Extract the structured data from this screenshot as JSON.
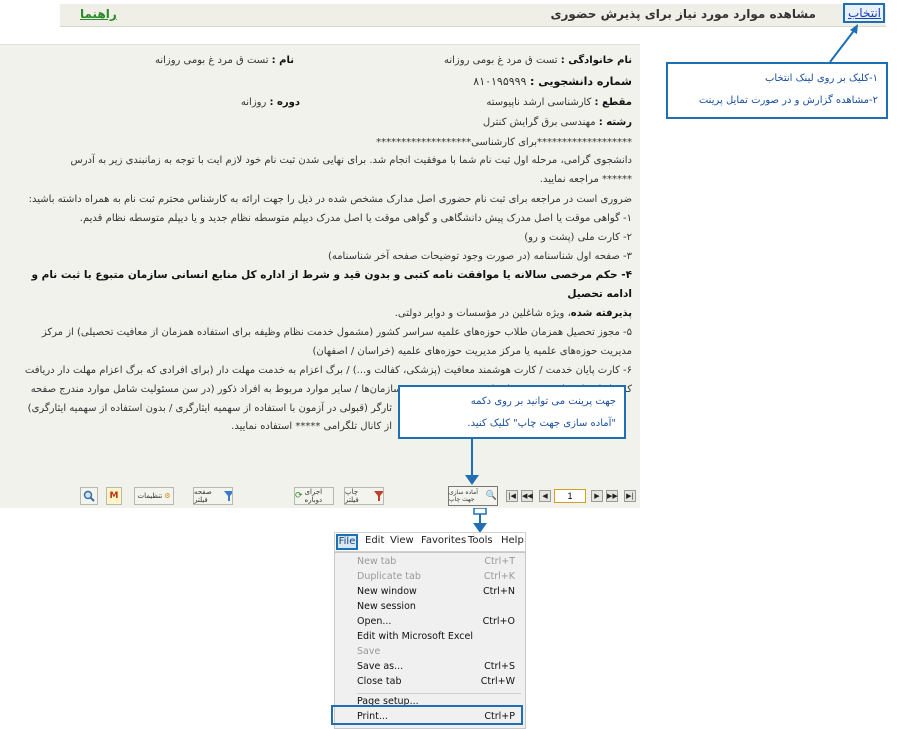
{
  "header": {
    "help_link": "راهنما",
    "title": "مشاهده موارد مورد نیاز برای پذیرش حضوری",
    "select_link": "انتخاب"
  },
  "student": {
    "last_name_label": "نام خانوادگی :",
    "last_name_value": "تست ق مرد غ بومی روزانه",
    "first_name_label": "نام :",
    "first_name_value": "تست ق مرد غ بومی روزانه",
    "student_id_label": "شماره دانشجویی :",
    "student_id_value": "۸۱۰۱۹۵۹۹۹",
    "level_label": "مقطع :",
    "level_value": "کارشناسی ارشد ناپیوسته",
    "period_label": "دوره :",
    "period_value": "روزانه",
    "major_label": "رشته :",
    "major_value": "مهندسی برق گرایش کنترل"
  },
  "body": {
    "stars_line": "*******************برای کارشناسی*******************",
    "para1": "دانشجوی گرامی، مرحله اول ثبت نام شما با موفقیت انجام شد. برای نهایی شدن ثبت نام خود لازم ایت با توجه به زمانبندی زیر به آدرس",
    "para1_cont": "****** مراجعه نمایید.",
    "para2": "ضروری است در مراجعه برای ثبت نام حضوری اصل مدارک مشخص شده در ذیل را جهت ارائه به کارشناس محترم ثبت نام به همراه داشته باشید:",
    "item1": "۱- گواهی موقت یا اصل مدرک پیش دانشگاهی و گواهی موقت یا اصل مدرک دیپلم متوسطه نظام جدید و یا دیپلم متوسطه نظام قدیم.",
    "item2": "۲- کارت ملی (پشت و رو)",
    "item3": "۳- صفحه اول شناسنامه (در صورت وجود توضیحات صفحه آخر شناسنامه)",
    "item4a": "۴- حکم مرخصی سالانه یا موافقت نامه",
    "item4b": "کتبی و بدون قید و شرط از اداره کل منابع انسانی سازمان متبوع با ثبت نام و ادامه تحصیل",
    "item4c": "پذیرفته شده",
    "item4d": "، ویژه شاغلین در مؤسسات و دوایر دولتی.",
    "item5": "۵- مجوز تحصیل همزمان طلاب حوزه‌های علمیه سراسر کشور (مشمول خدمت نظام وظیفه برای استفاده همزمان از معافیت تحصیلی) از مرکز",
    "item5_cont": "مدیریت حوزه‌های علمیه یا مرکز مدیریت حوزه‌های علمیه (خراسان / اصفهان)",
    "item6": "۶- کارت پایان خدمت / کارت هوشمند معافیت (پزشکی، کفالت و...) / برگ اعزام به خدمت مهلت دار (برای افرادی که برگ اعزام مهلت دار دریافت",
    "item6_cont": "کرده‌اند) / نامه یا مجوز مربوط برای متعهدین خدمت در سازمان‌ها / سایر موارد مربوط به افراد ذکور (در سن مسئولیت شامل موارد مندرج صفحه",
    "line_a": "ثارگر (قبولی در آزمون با استفاده از سهمیه ایثارگری / بدون استفاده از سهمیه ایثارگری)",
    "line_b": "از کانال تلگرامی ***** استفاده نمایید."
  },
  "callout1": {
    "line1": "۱-کلیک بر روی لینک انتخاب",
    "line2": "۲-مشاهده گزارش و در صورت تمایل پرینت"
  },
  "callout2": {
    "line1": "جهت پرینت می توانید بر روی دکمه",
    "line2": "\"آماده سازی جهت چاپ\" کلیک کنید."
  },
  "toolbar": {
    "search_icon": "search-icon",
    "settings_label": "تنظیمات",
    "filter_label": "صفحه فیلتر",
    "run_label": "اجرای دوباره",
    "print_filter_label": "چاپ فیلتر",
    "prepare_print_label": "آماده سازی جهت چاپ",
    "page_number": "1"
  },
  "menu": {
    "bar": [
      "File",
      "Edit",
      "View",
      "Favorites",
      "Tools",
      "Help"
    ],
    "items": [
      {
        "label": "New tab",
        "shortcut": "Ctrl+T",
        "disabled": true
      },
      {
        "label": "Duplicate tab",
        "shortcut": "Ctrl+K",
        "disabled": true
      },
      {
        "label": "New window",
        "shortcut": "Ctrl+N",
        "disabled": false
      },
      {
        "label": "New session",
        "shortcut": "",
        "disabled": false
      },
      {
        "label": "Open...",
        "shortcut": "Ctrl+O",
        "disabled": false
      },
      {
        "label": "Edit with Microsoft Excel",
        "shortcut": "",
        "disabled": false
      },
      {
        "label": "Save",
        "shortcut": "",
        "disabled": true
      },
      {
        "label": "Save as...",
        "shortcut": "Ctrl+S",
        "disabled": false
      },
      {
        "label": "Close tab",
        "shortcut": "Ctrl+W",
        "disabled": false
      },
      {
        "label": "Page setup...",
        "shortcut": "",
        "disabled": false
      },
      {
        "label": "Print...",
        "shortcut": "Ctrl+P",
        "disabled": false
      }
    ]
  },
  "colors": {
    "callout_border": "#1f6fb5",
    "link_blue": "#1a3fb8",
    "help_green": "#2a8a2a"
  }
}
